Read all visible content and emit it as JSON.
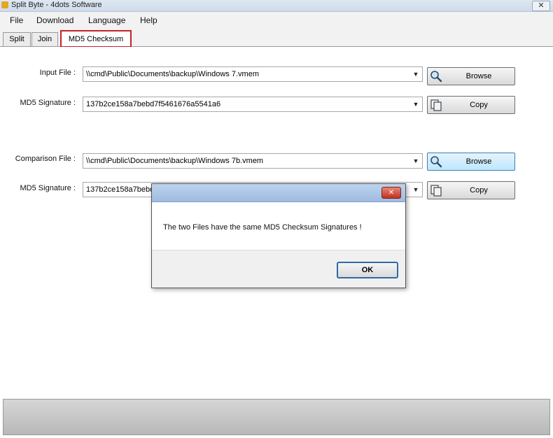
{
  "window": {
    "title": "Split Byte - 4dots Software",
    "close_glyph": "✕"
  },
  "menu": {
    "file": "File",
    "download": "Download",
    "language": "Language",
    "help": "Help"
  },
  "tabs": {
    "split": "Split",
    "join": "Join",
    "md5": "MD5 Checksum"
  },
  "form": {
    "input_file": {
      "label": "Input File :",
      "value": "\\\\cmd\\Public\\Documents\\backup\\Windows 7.vmem"
    },
    "md5_signature_1": {
      "label": "MD5 Signature :",
      "value": "137b2ce158a7bebd7f5461676a5541a6"
    },
    "comparison_file": {
      "label": "Comparison File :",
      "value": "\\\\cmd\\Public\\Documents\\backup\\Windows 7b.vmem"
    },
    "md5_signature_2": {
      "label": "MD5 Signature :",
      "value": "137b2ce158a7bebd"
    },
    "browse_label": "Browse",
    "copy_label": "Copy",
    "dropdown_glyph": "▼"
  },
  "dialog": {
    "close_glyph": "✕",
    "message": "The two Files have the same MD5 Checksum Signatures !",
    "ok_label": "OK"
  },
  "colors": {
    "tab_highlight": "#c8202a",
    "button_highlight": "#3c7fb1"
  }
}
